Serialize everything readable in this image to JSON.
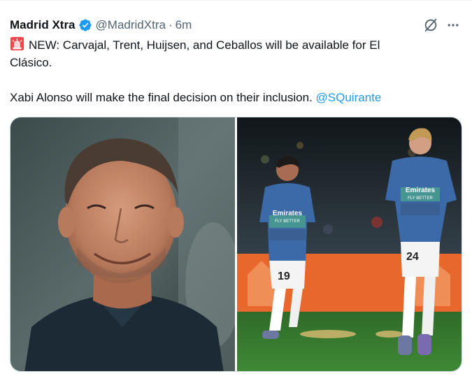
{
  "tweet": {
    "author_name": "Madrid Xtra",
    "handle": "@MadridXtra",
    "separator": "·",
    "time": "6m",
    "text_line1": "NEW: Carvajal, Trent, Huijsen, and Ceballos will be available for El",
    "text_line2": "Clásico.",
    "text_line3": "Xabi Alonso will make the final decision on their inclusion.",
    "mention": "@SQuirante"
  },
  "media": {
    "photo1": "portrait-smiling-man",
    "photo2": "two-players-warming-up",
    "shirt_brand": "Emirates",
    "shirt_slogan": "FLY BETTER",
    "number_left": "19",
    "number_right": "24"
  },
  "icons": {
    "siren": "siren-icon",
    "verified": "verified-badge-icon",
    "grok": "grok-icon",
    "more": "more-icon"
  },
  "colors": {
    "verified_blue": "#1d9bf0",
    "mention_blue": "#1d9bf0",
    "secondary_text": "#536471"
  }
}
